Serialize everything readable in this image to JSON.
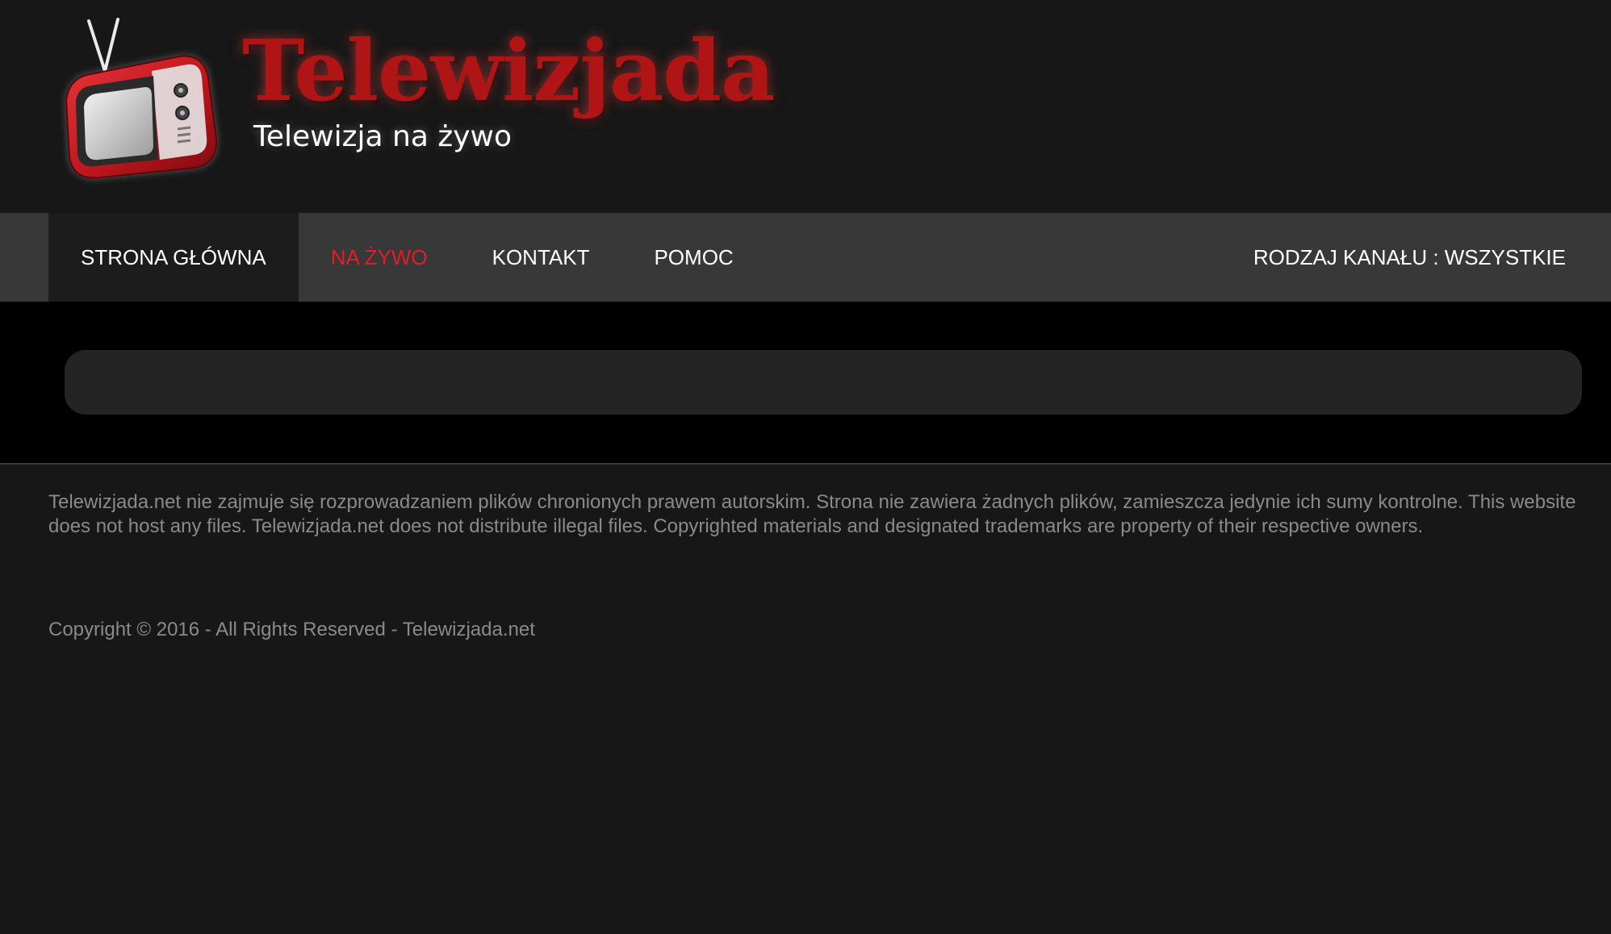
{
  "header": {
    "logo_title": "Telewizjada",
    "logo_tagline": "Telewizja na żywo"
  },
  "nav": {
    "items": [
      {
        "label": "STRONA GŁÓWNA"
      },
      {
        "label": "NA ŻYWO"
      },
      {
        "label": "KONTAKT"
      },
      {
        "label": "POMOC"
      }
    ],
    "channel_filter": "RODZAJ KANAŁU : WSZYSTKIE"
  },
  "footer": {
    "disclaimer": "Telewizjada.net nie zajmuje się rozprowadzaniem plików chronionych prawem autorskim. Strona nie zawiera żadnych plików, zamieszcza jedynie ich sumy kontrolne. This website does not host any files. Telewizjada.net does not distribute illegal files. Copyrighted materials and designated trademarks are property of their respective owners.",
    "copyright": "Copyright © 2016 - All Rights Reserved - Telewizjada.net"
  },
  "colors": {
    "background": "#171717",
    "nav_bg": "#383838",
    "nav_home_bg": "#1c1c1c",
    "active": "#e31d27",
    "brand_red": "#b01515",
    "footer_text": "#8a8a8a"
  },
  "icons": {
    "logo": "tv-icon"
  }
}
